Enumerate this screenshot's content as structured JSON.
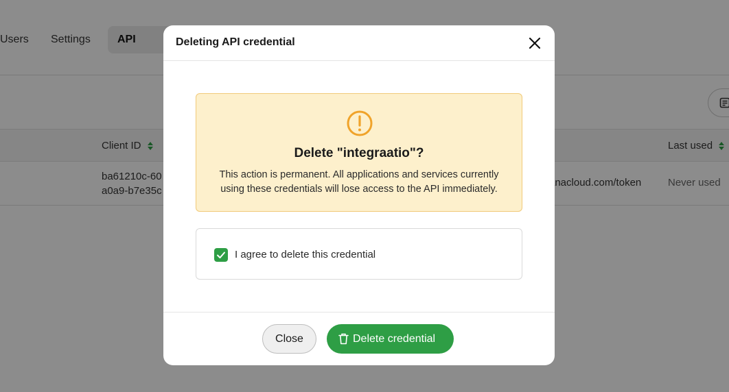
{
  "background": {
    "tabs": [
      {
        "label": "Users"
      },
      {
        "label": "Settings"
      },
      {
        "label": "API credentials"
      }
    ],
    "table": {
      "columns": [
        "Client ID",
        "Last used"
      ],
      "row": {
        "client_id_line1": "ba61210c-60",
        "client_id_line2": "a0a9-b7e35c",
        "token_url_fragment": "anacloud.com/token",
        "last_used": "Never used"
      }
    }
  },
  "modal": {
    "title": "Deleting API credential",
    "warning": {
      "icon": "exclamation-circle-icon",
      "heading": "Delete \"integraatio\"?",
      "text": "This action is permanent. All applications and services currently using these credentials will lose access to the API immediately."
    },
    "agree": {
      "checked": true,
      "label": "I agree to delete this credential"
    },
    "buttons": {
      "close_label": "Close",
      "delete_label": "Delete credential"
    }
  },
  "colors": {
    "accent_green": "#2e9e45",
    "warning_bg": "#fdf0cc",
    "warning_border": "#f1c978",
    "warning_icon": "#f0a32a"
  }
}
